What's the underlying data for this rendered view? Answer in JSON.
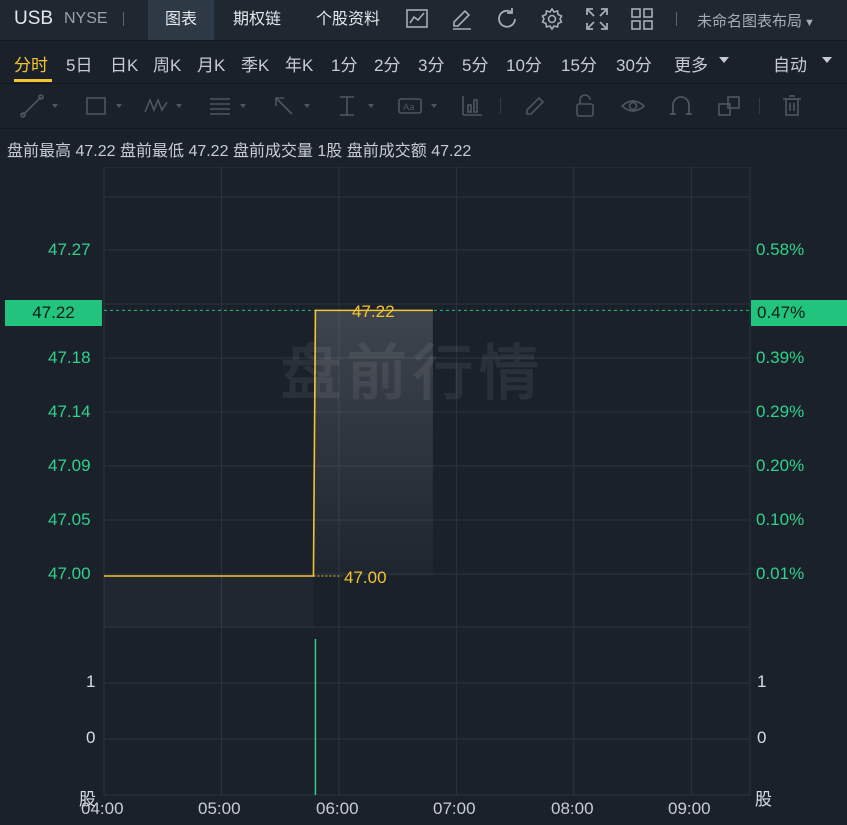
{
  "header": {
    "ticker": "USB",
    "exchange": "NYSE",
    "tabs": [
      {
        "label": "图表",
        "active": true
      },
      {
        "label": "期权链",
        "active": false
      },
      {
        "label": "个股资料",
        "active": false
      }
    ],
    "icons": [
      "chart-line-icon",
      "edit-pen-icon",
      "refresh-icon",
      "settings-gear-icon",
      "fullscreen-icon",
      "grid-layout-icon"
    ],
    "layout_label": "未命名图表布局"
  },
  "periods": {
    "items": [
      "分时",
      "5日",
      "日K",
      "周K",
      "月K",
      "季K",
      "年K",
      "1分",
      "2分",
      "3分",
      "5分",
      "10分",
      "15分",
      "30分",
      "更多"
    ],
    "active": "分时",
    "mode": "自动"
  },
  "info": {
    "high_label": "盘前最高",
    "high_value": "47.22",
    "low_label": "盘前最低",
    "low_value": "47.22",
    "vol_label": "盘前成交量",
    "vol_value": "1股",
    "amt_label": "盘前成交额",
    "amt_value": "47.22"
  },
  "chart": {
    "watermark": "盘前行情",
    "price_axis_left": [
      "47.27",
      "47.18",
      "47.14",
      "47.09",
      "47.05",
      "47.00"
    ],
    "price_axis_right": [
      "0.58%",
      "0.39%",
      "0.29%",
      "0.20%",
      "0.10%",
      "0.01%"
    ],
    "current_price": "47.22",
    "current_pct": "0.47%",
    "high_marker": "47.22",
    "low_marker": "47.00",
    "volume_axis_left": [
      "1",
      "0"
    ],
    "volume_axis_right": [
      "1",
      "0"
    ],
    "volume_unit": "股",
    "x_axis": [
      "04:00",
      "05:00",
      "06:00",
      "07:00",
      "08:00",
      "09:00"
    ],
    "colors": {
      "line": "#f4c430",
      "up": "#2fd28a",
      "badge": "#21c37d"
    }
  },
  "chart_data": {
    "type": "line",
    "title": "",
    "xlabel": "",
    "ylabel": "",
    "price_series": {
      "name": "",
      "x": [
        "04:00",
        "05:47",
        "05:48",
        "06:48"
      ],
      "values": [
        47.0,
        47.0,
        47.22,
        47.22
      ]
    },
    "volume_series": {
      "name": "",
      "x": [
        "05:48"
      ],
      "values": [
        1
      ]
    },
    "ylim": [
      46.95,
      47.3
    ],
    "y2_labels": [
      "0.58%",
      "0.47%",
      "0.39%",
      "0.29%",
      "0.20%",
      "0.10%",
      "0.01%"
    ],
    "xlim": [
      "04:00",
      "09:30"
    ],
    "grid": true
  }
}
